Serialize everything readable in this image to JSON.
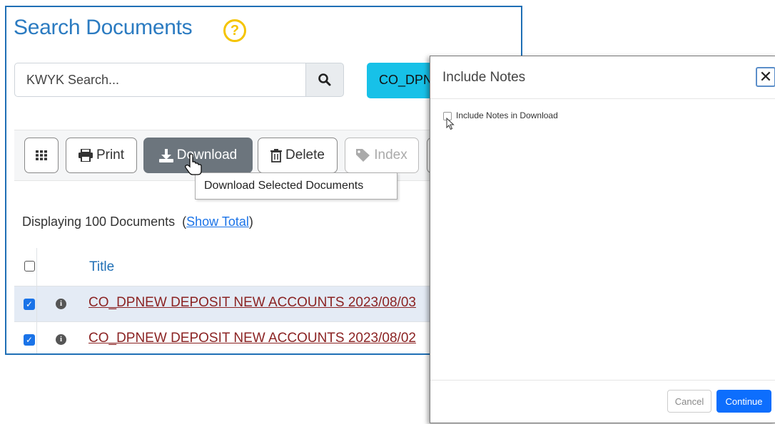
{
  "page": {
    "title": "Search Documents",
    "help_symbol": "?"
  },
  "search": {
    "placeholder": "KWYK Search...",
    "filter_badge": "CO_DPNEW"
  },
  "toolbar": {
    "grid_label": "",
    "print_label": "Print",
    "download_label": "Download",
    "delete_label": "Delete",
    "index_label": "Index"
  },
  "tooltip": {
    "text": "Download Selected Documents"
  },
  "results": {
    "prefix": "Displaying 100 Documents",
    "open_paren": "(",
    "show_total_link": "Show Total",
    "close_paren": ")"
  },
  "table": {
    "header_title": "Title",
    "rows": [
      {
        "title": "CO_DPNEW DEPOSIT NEW ACCOUNTS 2023/08/03",
        "checked": true
      },
      {
        "title": "CO_DPNEW DEPOSIT NEW ACCOUNTS 2023/08/02",
        "checked": true
      }
    ]
  },
  "modal": {
    "title": "Include Notes",
    "close_symbol": "✕",
    "checkbox_label": "Include Notes in Download",
    "cancel_label": "Cancel",
    "continue_label": "Continue"
  },
  "colors": {
    "brand_blue": "#2b7bc1",
    "primary": "#0d6efd",
    "badge_cyan": "#17c1e8",
    "help_yellow": "#f5c400",
    "link_red": "#8b2323",
    "active_button": "#6c757d"
  }
}
